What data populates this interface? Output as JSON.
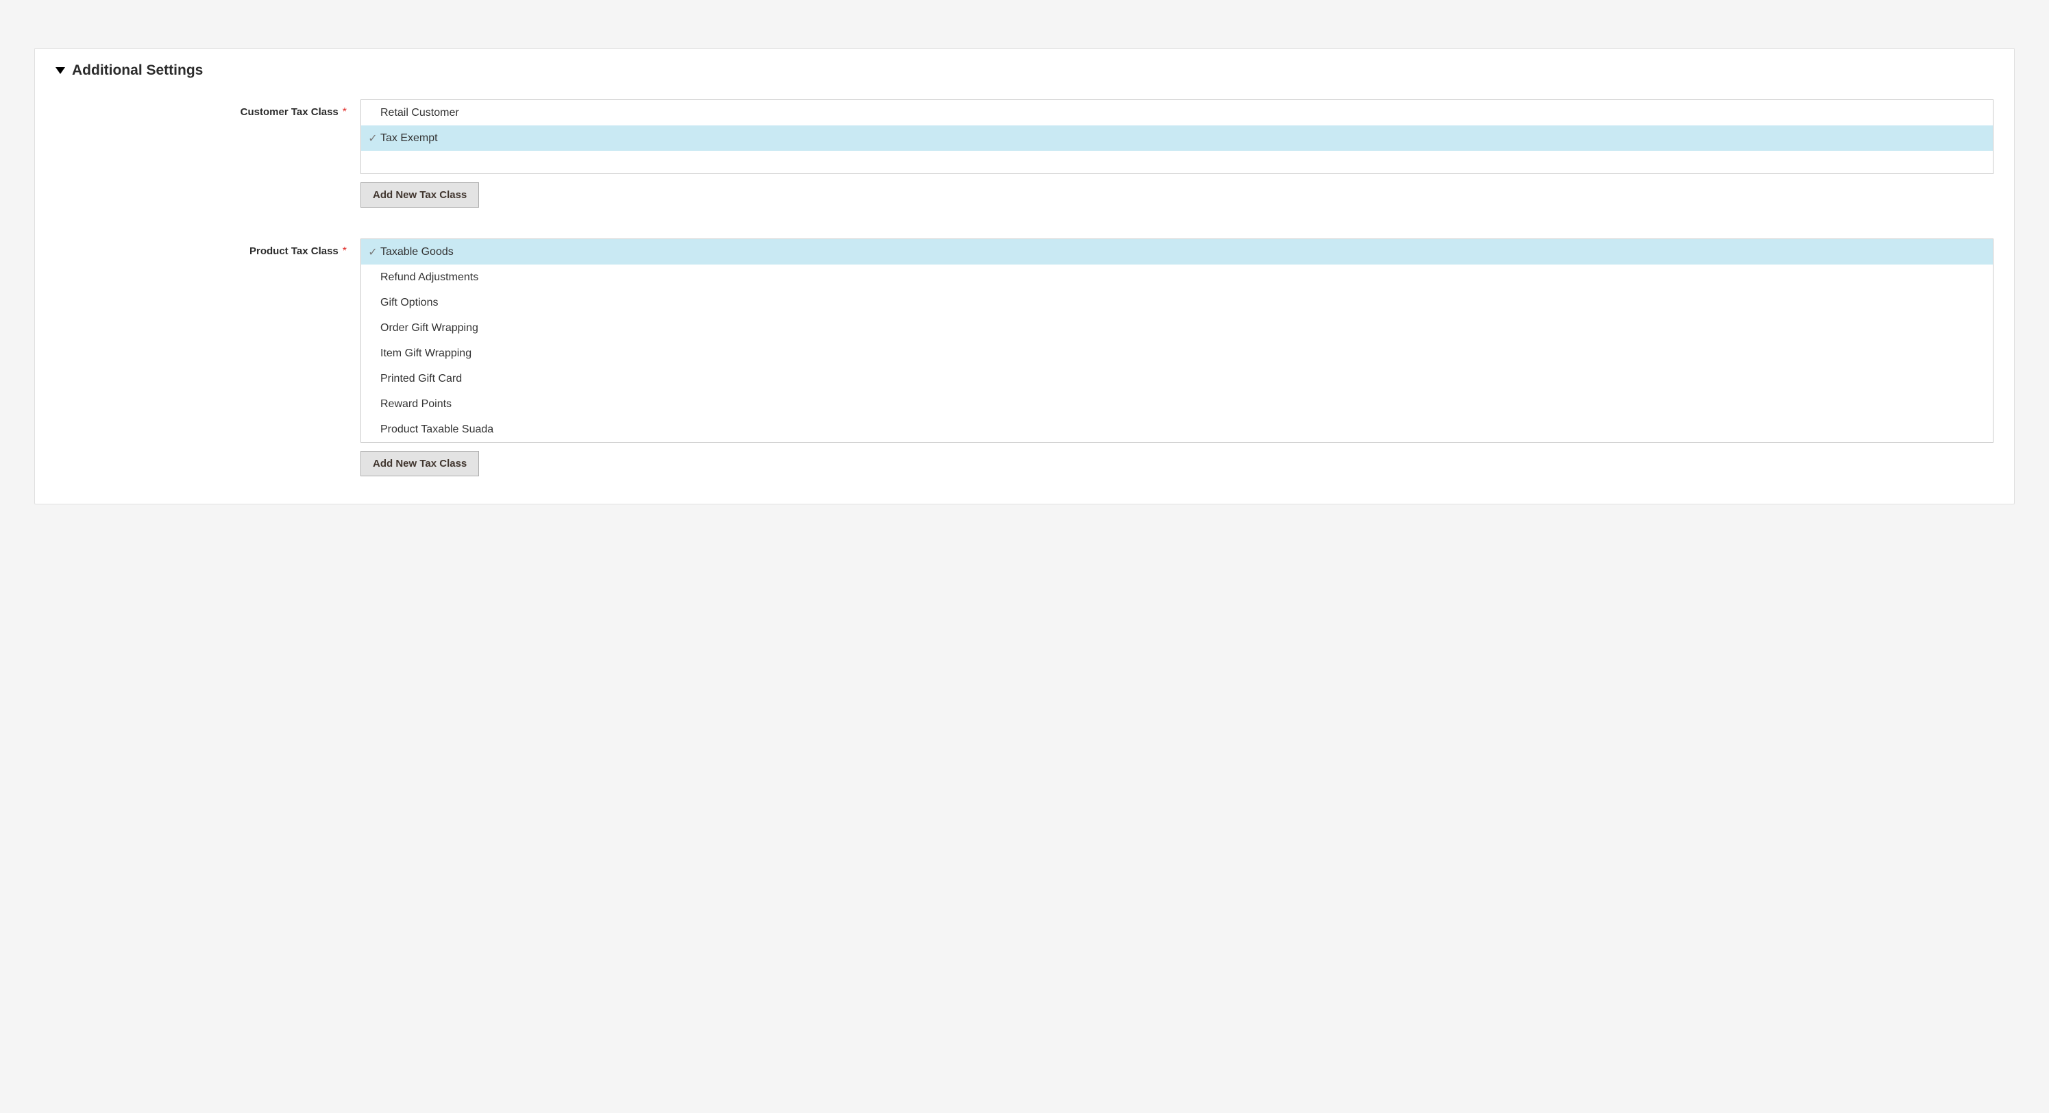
{
  "section": {
    "title": "Additional Settings"
  },
  "customer_tax_class": {
    "label": "Customer Tax Class",
    "options": [
      {
        "label": "Retail Customer",
        "selected": false
      },
      {
        "label": "Tax Exempt",
        "selected": true
      }
    ],
    "add_button": "Add New Tax Class"
  },
  "product_tax_class": {
    "label": "Product Tax Class",
    "options": [
      {
        "label": "Taxable Goods",
        "selected": true
      },
      {
        "label": "Refund Adjustments",
        "selected": false
      },
      {
        "label": "Gift Options",
        "selected": false
      },
      {
        "label": "Order Gift Wrapping",
        "selected": false
      },
      {
        "label": "Item Gift Wrapping",
        "selected": false
      },
      {
        "label": "Printed Gift Card",
        "selected": false
      },
      {
        "label": "Reward Points",
        "selected": false
      },
      {
        "label": "Product Taxable Suada",
        "selected": false
      }
    ],
    "add_button": "Add New Tax Class"
  }
}
